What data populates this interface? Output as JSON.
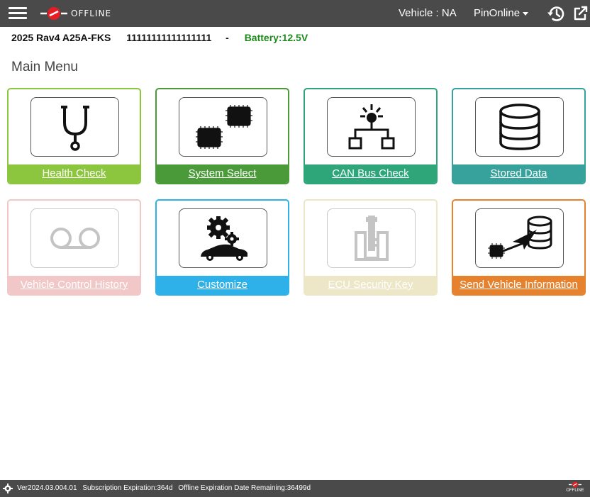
{
  "topbar": {
    "offline_label": "OFFLINE",
    "vehicle": "Vehicle : NA",
    "pin_mode": "PinOnline"
  },
  "vehicle_info": {
    "model": "2025 Rav4 A25A-FKS",
    "vin": "11111111111111111",
    "separator": "-",
    "battery": "Battery:12.5V"
  },
  "main_menu": {
    "title": "Main Menu",
    "tiles": [
      {
        "label": "Health Check",
        "color": "#8cc63f",
        "enabled": true
      },
      {
        "label": "System Select",
        "color": "#4a9a3a",
        "enabled": true
      },
      {
        "label": "CAN Bus Check",
        "color": "#2fa57a",
        "enabled": true
      },
      {
        "label": "Stored Data",
        "color": "#37a19b",
        "enabled": true
      },
      {
        "label": "Vehicle Control History",
        "color": "#f2c7c7",
        "enabled": false
      },
      {
        "label": "Customize",
        "color": "#2eb1e8",
        "enabled": true
      },
      {
        "label": "ECU Security Key",
        "color": "#ede6c7",
        "enabled": false
      },
      {
        "label": "Send Vehicle Information",
        "color": "#e6812e",
        "enabled": true
      }
    ]
  },
  "footer": {
    "version": "Ver2024.03.004.01",
    "subscription": "Subscription Expiration:364d",
    "offline_expiration": "Offline Expiration Date Remaining:36499d",
    "offline_badge": "OFFLINE"
  }
}
